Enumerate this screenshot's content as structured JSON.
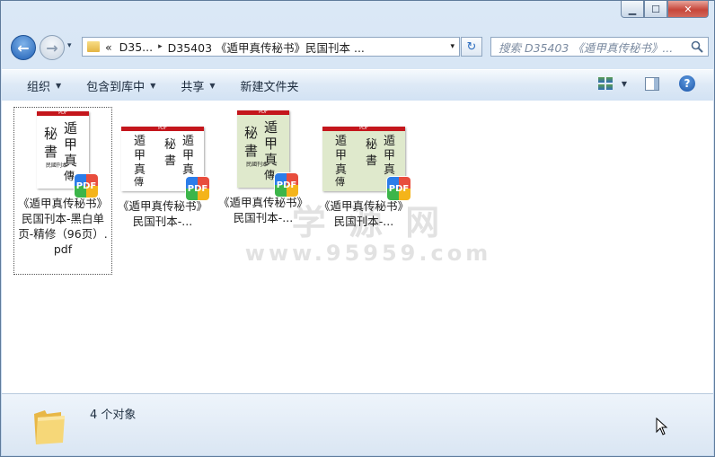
{
  "window": {
    "caption_buttons": {
      "minimize": "▁",
      "maximize": "☐",
      "close": "✕"
    }
  },
  "nav": {
    "back_icon": "←",
    "forward_icon": "→",
    "history_dropdown": "▾"
  },
  "address": {
    "overflow": "«",
    "crumbs": [
      "D35...",
      "D35403 《遁甲真传秘书》民国刊本 ..."
    ],
    "separator": "▸",
    "dropdown": "▾",
    "refresh_icon": "↻"
  },
  "search": {
    "placeholder": "搜索 D35403 《遁甲真传秘书》..."
  },
  "toolbar": {
    "organize": "组织",
    "include_in_library": "包含到库中",
    "share": "共享",
    "new_folder": "新建文件夹",
    "dropdown_arrow": "▼",
    "help": "?"
  },
  "files": [
    {
      "name": "《遁甲真传秘书》民国刊本-黑白单页-精修（96页）.pdf",
      "thumb_bg": "#ffffff",
      "layout": "single",
      "selected": true
    },
    {
      "name": "《遁甲真传秘书》民国刊本-...",
      "thumb_bg": "#ffffff",
      "layout": "double",
      "selected": false
    },
    {
      "name": "《遁甲真传秘书》民国刊本-...",
      "thumb_bg": "#dfe9cc",
      "layout": "single",
      "selected": false
    },
    {
      "name": "《遁甲真传秘书》民国刊本-...",
      "thumb_bg": "#dfe9cc",
      "layout": "double",
      "selected": false
    }
  ],
  "thumb": {
    "header": "PDF",
    "badge": "PDF"
  },
  "watermark": {
    "line1": "学 源 网",
    "line2": "www.95959.com"
  },
  "status": {
    "count_text": "4 个对象"
  },
  "colors": {
    "accent": "#2b6cbf",
    "pdf_red": "#c4161c"
  }
}
